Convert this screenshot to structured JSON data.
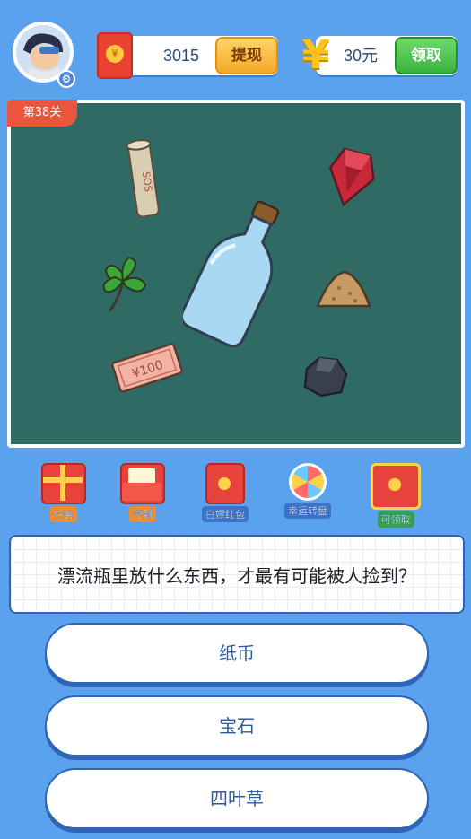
{
  "header": {
    "coin_balance": "3015",
    "withdraw_label": "提现",
    "cash_amount": "30元",
    "claim_label": "领取",
    "redpacket_symbol": "¥",
    "yuan_symbol": "¥"
  },
  "board": {
    "level_label": "第38关",
    "item_icons": [
      "paper-money-icon",
      "gemstone-icon",
      "four-leaf-clover-icon",
      "sos-note-icon",
      "sand-pile-icon",
      "coal-lump-icon",
      "drift-bottle-icon"
    ]
  },
  "features": [
    {
      "label": "任务",
      "icon": "gift-box-icon"
    },
    {
      "label": "签到",
      "icon": "checkin-envelope-icon"
    },
    {
      "label": "白嫖红包",
      "icon": "red-envelope-icon"
    },
    {
      "label": "幸运转盘",
      "icon": "lucky-wheel-icon"
    },
    {
      "label": "可领取",
      "icon": "claimable-redpacket-icon"
    }
  ],
  "question": {
    "text": "漂流瓶里放什么东西，才最有可能被人捡到？"
  },
  "answers": [
    {
      "label": "纸币"
    },
    {
      "label": "宝石"
    },
    {
      "label": "四叶草"
    }
  ],
  "colors": {
    "background": "#5aa1ee",
    "board": "#2f6a64",
    "accent_blue": "#2e65b7",
    "withdraw_button": "#f4a927",
    "claim_button": "#37b43a",
    "level_tag": "#e9563d"
  }
}
